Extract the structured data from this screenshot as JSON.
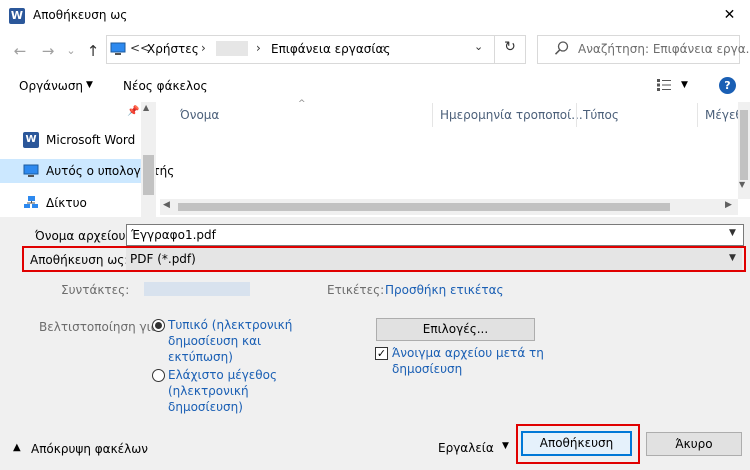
{
  "window": {
    "app_icon_letter": "W",
    "title": "Αποθήκευση ως",
    "close_glyph": "✕"
  },
  "address": {
    "overflow": "<<",
    "crumbs": [
      "Χρήστες",
      "Επιφάνεια εργασίας"
    ],
    "separator": "›",
    "dropdown_glyph": "⌄",
    "refresh_glyph": "↻"
  },
  "search": {
    "placeholder": "Αναζήτηση: Επιφάνεια εργα..."
  },
  "nav_buttons": {
    "back": "←",
    "forward": "→",
    "recent": "⌄",
    "up": "↑"
  },
  "toolbar": {
    "organize": "Οργάνωση",
    "new_folder": "Νέος φάκελος",
    "help": "?"
  },
  "nav_pane": {
    "items": [
      {
        "label": "Microsoft Word",
        "icon": "word-icon"
      },
      {
        "label": "Αυτός ο υπολογιστής",
        "icon": "computer-icon",
        "selected": true
      },
      {
        "label": "Δίκτυο",
        "icon": "network-icon"
      }
    ]
  },
  "file_list": {
    "columns": [
      "Όνομα",
      "Ημερομηνία τροποποί...",
      "Τύπος",
      "Μέγεθ"
    ]
  },
  "form": {
    "filename_label": "Όνομα αρχείου:",
    "filename_value": "Έγγραφο1.pdf",
    "savetype_label": "Αποθήκευση ως:",
    "savetype_value": "PDF (*.pdf)",
    "authors_label": "Συντάκτες:",
    "tags_label": "Ετικέτες:",
    "tags_link": "Προσθήκη ετικέτας",
    "optimize_label": "Βελτιστοποίηση για:",
    "radio_standard": [
      "Τυπικό (ηλεκτρονική",
      "δημοσίευση και",
      "εκτύπωση)"
    ],
    "radio_minimum": [
      "Ελάχιστο μέγεθος",
      "(ηλεκτρονική",
      "δημοσίευση)"
    ],
    "options_button": "Επιλογές...",
    "open_after_publish": [
      "Άνοιγμα αρχείου μετά τη",
      "δημοσίευση"
    ],
    "open_after_checked": true
  },
  "bottom": {
    "hide_folders": "Απόκρυψη φακέλων",
    "tools": "Εργαλεία",
    "save": "Αποθήκευση",
    "cancel": "Άκυρο"
  },
  "colors": {
    "accent": "#0078d7",
    "highlight_red": "#e00000",
    "link_blue": "#1a5fb4",
    "selection": "#cce8ff"
  }
}
